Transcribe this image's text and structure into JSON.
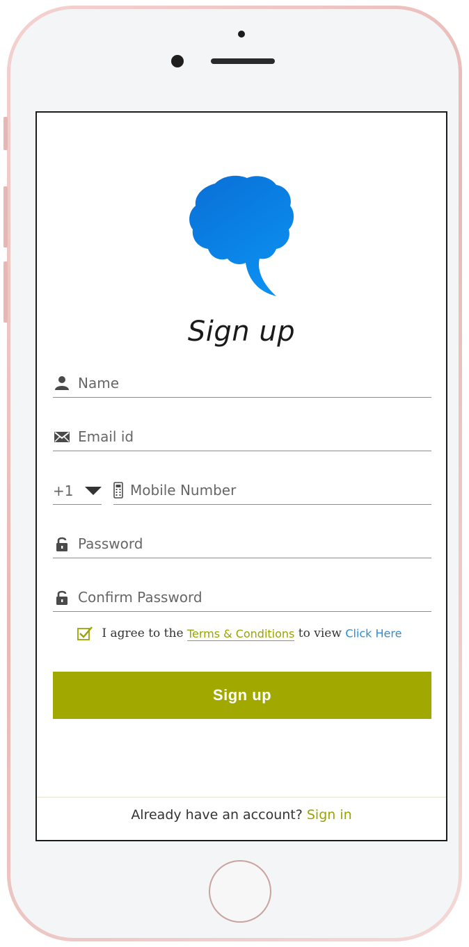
{
  "screen": {
    "title": "Sign up"
  },
  "form": {
    "name_placeholder": "Name",
    "email_placeholder": "Email id",
    "country_code": "+1",
    "mobile_placeholder": "Mobile Number",
    "password_placeholder": "Password",
    "confirm_password_placeholder": "Confirm Password",
    "agree_prefix": "I agree to the",
    "terms_link": "Terms & Conditions",
    "agree_middle": "to view",
    "click_here_link": "Click Here",
    "agree_checked": true,
    "submit_label": "Sign up"
  },
  "footer": {
    "prompt": "Already have an account?",
    "signin_link": "Sign in"
  },
  "icons": {
    "logo": "brain-speech-bubble-icon",
    "name": "user-icon",
    "email": "envelope-icon",
    "country": "caret-down-icon",
    "mobile": "mobile-phone-icon",
    "password": "lock-icon",
    "confirm_password": "lock-icon",
    "agree": "checkbox-checked-icon"
  },
  "colors": {
    "accent": "#a1a800",
    "link_blue": "#2d8de0",
    "logo_blue": "#0a7ee0"
  }
}
